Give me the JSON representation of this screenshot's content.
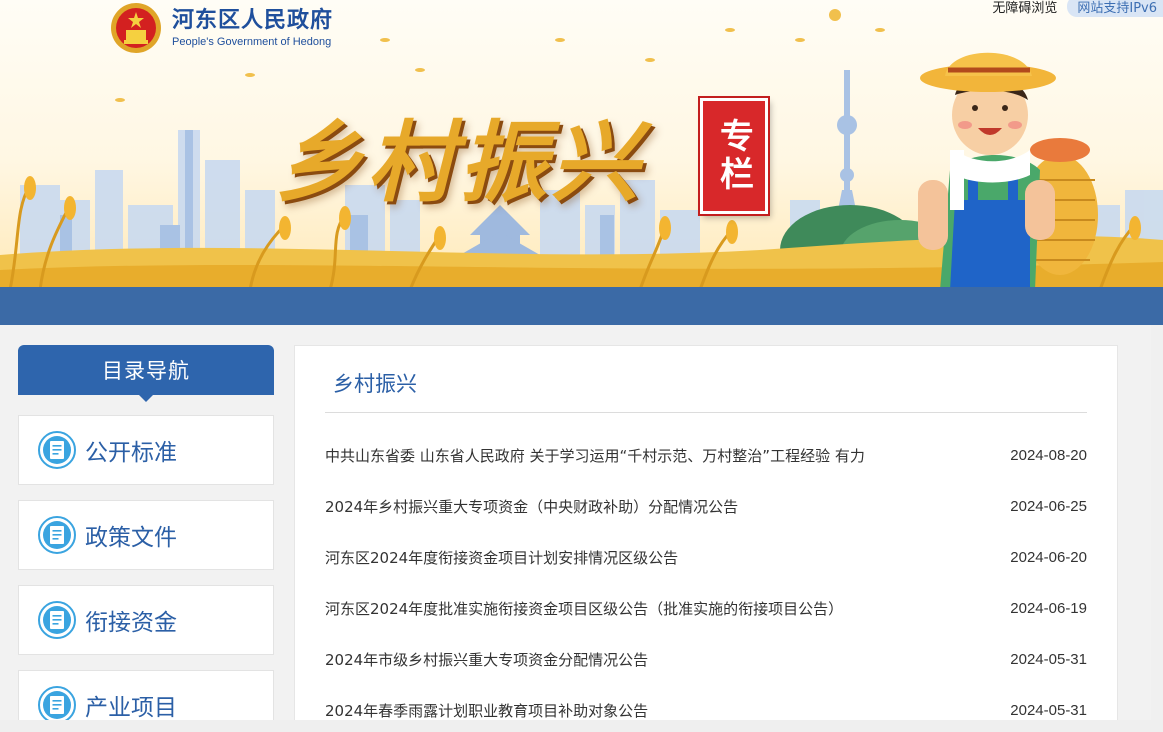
{
  "header": {
    "org_name_cn": "河东区人民政府",
    "org_name_en": "People's Government of Hedong",
    "accessible_link": "无障碍浏览",
    "ipv6_badge": "网站支持IPv6",
    "banner_title": "乡村振兴",
    "banner_tag": "专栏",
    "emblem_icon": "national-emblem-icon"
  },
  "sidebar": {
    "header": "目录导航",
    "items": [
      {
        "label": "公开标准",
        "icon": "document-icon"
      },
      {
        "label": "政策文件",
        "icon": "document-icon"
      },
      {
        "label": "衔接资金",
        "icon": "document-icon"
      },
      {
        "label": "产业项目",
        "icon": "document-icon"
      }
    ]
  },
  "main": {
    "section_title": "乡村振兴",
    "news": [
      {
        "title": "中共山东省委 山东省人民政府 关于学习运用“千村示范、万村整治”工程经验 有力",
        "date": "2024-08-20"
      },
      {
        "title": "2024年乡村振兴重大专项资金（中央财政补助）分配情况公告",
        "date": "2024-06-25"
      },
      {
        "title": "河东区2024年度衔接资金项目计划安排情况区级公告",
        "date": "2024-06-20"
      },
      {
        "title": "河东区2024年度批准实施衔接资金项目区级公告（批准实施的衔接项目公告）",
        "date": "2024-06-19"
      },
      {
        "title": "2024年市级乡村振兴重大专项资金分配情况公告",
        "date": "2024-05-31"
      },
      {
        "title": "2024年春季雨露计划职业教育项目补助对象公告",
        "date": "2024-05-31"
      }
    ]
  },
  "colors": {
    "primary_blue": "#2e65ad",
    "bar_blue": "#3b6aa6",
    "gold": "#e7a92a",
    "red_tag": "#d8282a"
  }
}
